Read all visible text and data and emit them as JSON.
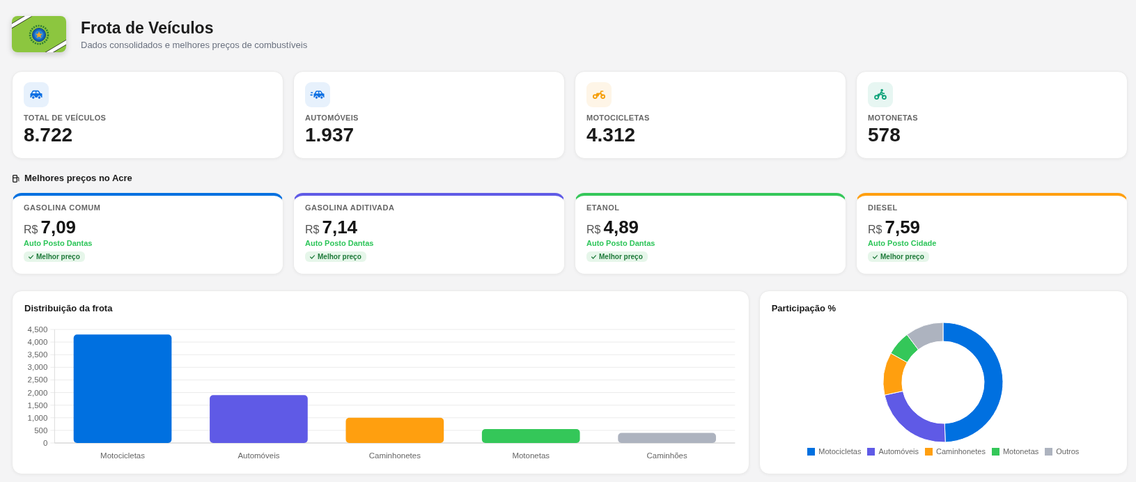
{
  "header": {
    "title": "Frota de Veículos",
    "subtitle": "Dados consolidados e melhores preços de combustíveis"
  },
  "stats": [
    {
      "kind": "car",
      "label": "TOTAL DE VEÍCULOS",
      "value": "8.722",
      "color": "#0b6fe3"
    },
    {
      "kind": "fast_car",
      "label": "AUTOMÓVEIS",
      "value": "1.937",
      "color": "#0b6fe3"
    },
    {
      "kind": "motorcycle",
      "label": "MOTOCICLETAS",
      "value": "4.312",
      "color": "#f59e0b"
    },
    {
      "kind": "scooter",
      "label": "MOTONETAS",
      "value": "578",
      "color": "#10a37a"
    }
  ],
  "fuel_prices": {
    "title": "Melhores preços no Acre",
    "cards": [
      {
        "fuel": "GASOLINA COMUM",
        "currency": "R$",
        "price": "7,09",
        "station": "Auto Posto Dantas",
        "badge": "Melhor preço",
        "color": "#0070e0"
      },
      {
        "fuel": "GASOLINA ADITIVADA",
        "currency": "R$",
        "price": "7,14",
        "station": "Auto Posto Dantas",
        "badge": "Melhor preço",
        "color": "#5f5ae6"
      },
      {
        "fuel": "ETANOL",
        "currency": "R$",
        "price": "4,89",
        "station": "Auto Posto Dantas",
        "badge": "Melhor preço",
        "color": "#34c759"
      },
      {
        "fuel": "DIESEL",
        "currency": "R$",
        "price": "7,59",
        "station": "Auto Posto Cidade",
        "badge": "Melhor preço",
        "color": "#ff9f0f"
      }
    ]
  },
  "charts": [
    {
      "chart_data": {
        "type": "bar",
        "title": "Distribuição da frota",
        "categories": [
          "Motocicletas",
          "Automóveis",
          "Caminhonetes",
          "Motonetas",
          "Caminhões"
        ],
        "values": [
          4300,
          1900,
          1000,
          550,
          400
        ],
        "colors": [
          "#0070e0",
          "#5f5ae6",
          "#ff9f0f",
          "#34c759",
          "#adb3bf"
        ],
        "grid": true,
        "ylim": [
          0,
          4500
        ],
        "yticks": [
          {
            "value": 0,
            "label": "0"
          },
          {
            "value": 500,
            "label": "500"
          },
          {
            "value": 1000,
            "label": "1,000"
          },
          {
            "value": 1500,
            "label": "1,500"
          },
          {
            "value": 2000,
            "label": "2,000"
          },
          {
            "value": 2500,
            "label": "2,500"
          },
          {
            "value": 3000,
            "label": "3,000"
          },
          {
            "value": 3500,
            "label": "3,500"
          },
          {
            "value": 4000,
            "label": "4,000"
          },
          {
            "value": 4500,
            "label": "4,500"
          }
        ]
      }
    },
    {
      "chart_data": {
        "type": "donut",
        "title": "Participação %",
        "categories": [
          "Motocicletas",
          "Automóveis",
          "Caminhonetes",
          "Motonetas",
          "Outros"
        ],
        "values": [
          49.4,
          22.2,
          11.5,
          6.6,
          10.3
        ],
        "colors": [
          "#0070e0",
          "#5f5ae6",
          "#ff9f0f",
          "#34c759",
          "#adb3bf"
        ]
      }
    }
  ]
}
